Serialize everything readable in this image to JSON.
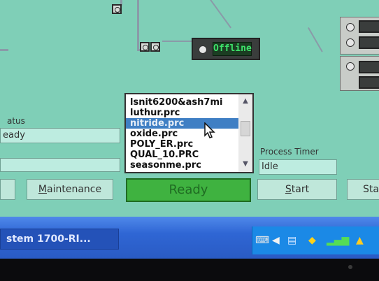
{
  "status_panel": {
    "status_label": "atus",
    "status_value": "eady",
    "second_value": ""
  },
  "chamber_status": {
    "text": "Offline",
    "text_color": "#3ee36a"
  },
  "recipe_list": {
    "items": [
      "lsnit6200&ash7mi",
      "luthur.prc",
      "nitride.prc",
      "oxide.prc",
      "POLY_ER.prc",
      "QUAL_10.PRC",
      "seasonme.prc"
    ],
    "selected": "nitride.prc"
  },
  "process_timer": {
    "label": "Process Timer",
    "value": "Idle"
  },
  "buttons": {
    "maintenance_label": "Maintenance",
    "maintenance_mnemonic": "M",
    "maintenance_rest": "aintenance",
    "ready_label": "Ready",
    "start_mnemonic": "S",
    "start_rest": "tart",
    "partial_label": "Sta"
  },
  "taskbar": {
    "task_label": "stem 1700-RI..."
  },
  "colors": {
    "screen_bg": "#7fcfb7",
    "ready_green": "#3fb240",
    "selection_blue": "#3f7fc4",
    "taskbar_blue": "#2f66d4"
  },
  "icons": [
    "scroll-up-arrow-icon",
    "scroll-down-arrow-icon",
    "mouse-cursor-icon",
    "tray-keyboard-icon",
    "tray-speaker-icon",
    "tray-network-icon",
    "tray-shield-icon",
    "tray-signal-icon",
    "tray-warning-icon"
  ]
}
